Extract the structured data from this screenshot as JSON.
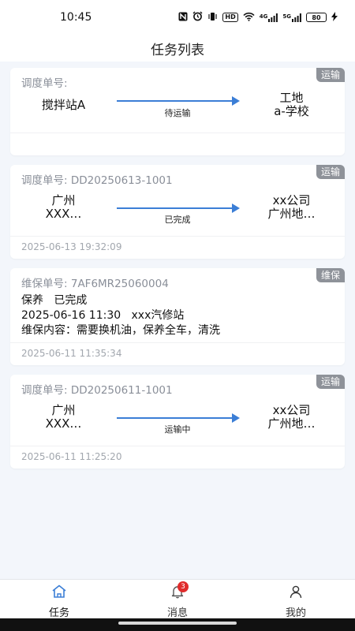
{
  "status_bar": {
    "time": "10:45",
    "icons": [
      "nfc-icon",
      "alarm-icon",
      "vibrate-icon",
      "hd-icon",
      "wifi-icon",
      "signal-4g-icon",
      "signal-5g-icon"
    ],
    "signal_4g": "4G",
    "signal_5g": "5G",
    "hd": "HD",
    "battery": "80"
  },
  "header": {
    "title": "任务列表"
  },
  "cards": [
    {
      "type": "transport",
      "tag": "运输",
      "id_label": "调度单号:",
      "id_value": "",
      "from": [
        "搅拌站A"
      ],
      "to": [
        "工地",
        "a-学校"
      ],
      "status": "待运输",
      "time": ""
    },
    {
      "type": "transport",
      "tag": "运输",
      "id_label": "调度单号:",
      "id_value": "DD20250613-1001",
      "from": [
        "广州",
        "XXX…"
      ],
      "to": [
        "xx公司",
        "广州地…"
      ],
      "status": "已完成",
      "time": "2025-06-13 19:32:09"
    },
    {
      "type": "maintenance",
      "tag": "维保",
      "id_label": "维保单号:",
      "id_value": "7AF6MR25060004",
      "line1": "保养   已完成",
      "line2": "2025-06-16 11:30   xxx汽修站",
      "line3": "维保内容：需要换机油，保养全车，清洗",
      "time": "2025-06-11 11:35:34"
    },
    {
      "type": "transport",
      "tag": "运输",
      "id_label": "调度单号:",
      "id_value": "DD20250611-1001",
      "from": [
        "广州",
        "XXX…"
      ],
      "to": [
        "xx公司",
        "广州地…"
      ],
      "status": "运输中",
      "time": "2025-06-11 11:25:20"
    }
  ],
  "tabbar": {
    "tasks": "任务",
    "messages": "消息",
    "messages_badge": "3",
    "mine": "我的"
  },
  "colors": {
    "accent": "#3b7ed6",
    "tag_bg": "#8e9299",
    "badge": "#e02b2b",
    "active_tab": "#3b7ed6"
  }
}
